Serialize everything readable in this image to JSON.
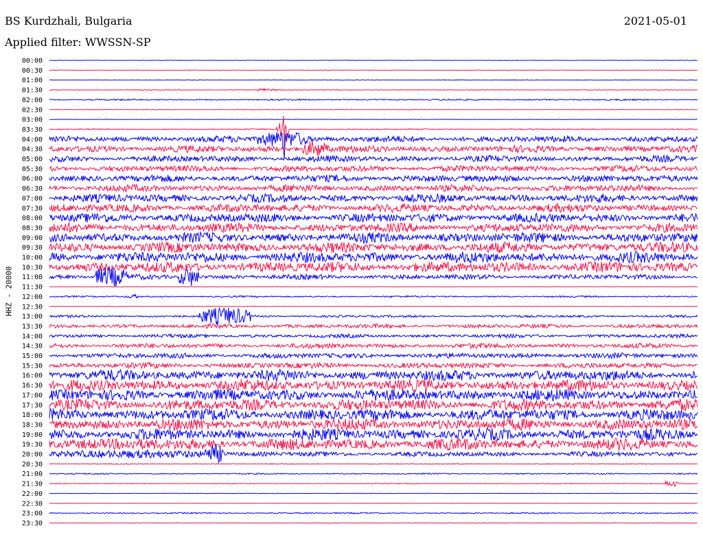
{
  "header": {
    "station": "BS Kurdzhali, Bulgaria",
    "filter": "Applied filter: WWSSN-SP",
    "date": "2021-05-01"
  },
  "chart_data": {
    "type": "line",
    "title": "BS Kurdzhali, Bulgaria",
    "subtitle": "Applied filter: WWSSN-SP",
    "ylabel": "HHZ - 20000",
    "colors": {
      "even_row": "#0000ee",
      "odd_row": "#f0144b"
    },
    "rows": [
      {
        "time": "00:00",
        "noise": 0.3,
        "events": []
      },
      {
        "time": "00:30",
        "noise": 0.3,
        "events": []
      },
      {
        "time": "01:00",
        "noise": 0.3,
        "events": []
      },
      {
        "time": "01:30",
        "noise": 0.4,
        "events": [
          {
            "start": 0.32,
            "end": 0.44,
            "amp": 3,
            "shape": "decay"
          }
        ]
      },
      {
        "time": "02:00",
        "noise": 0.9,
        "events": []
      },
      {
        "time": "02:30",
        "noise": 0.4,
        "events": []
      },
      {
        "time": "03:00",
        "noise": 0.3,
        "events": []
      },
      {
        "time": "03:30",
        "noise": 0.7,
        "events": [
          {
            "start": 0.35,
            "end": 0.37,
            "amp": 40,
            "shape": "spike"
          }
        ]
      },
      {
        "time": "04:00",
        "noise": 3.8,
        "events": [
          {
            "start": 0.32,
            "end": 0.4,
            "amp": 12,
            "shape": "burst"
          },
          {
            "start": 0.359,
            "end": 0.365,
            "amp": 32,
            "shape": "spike"
          }
        ]
      },
      {
        "time": "04:30",
        "noise": 4.2,
        "events": [
          {
            "start": 0.39,
            "end": 0.43,
            "amp": 12,
            "shape": "burst"
          }
        ]
      },
      {
        "time": "05:00",
        "noise": 3.8,
        "events": []
      },
      {
        "time": "05:30",
        "noise": 3.8,
        "events": []
      },
      {
        "time": "06:00",
        "noise": 4.2,
        "events": []
      },
      {
        "time": "06:30",
        "noise": 4.2,
        "events": []
      },
      {
        "time": "07:00",
        "noise": 5,
        "events": []
      },
      {
        "time": "07:30",
        "noise": 5,
        "events": []
      },
      {
        "time": "08:00",
        "noise": 5.5,
        "events": []
      },
      {
        "time": "08:30",
        "noise": 5.5,
        "events": []
      },
      {
        "time": "09:00",
        "noise": 6,
        "events": []
      },
      {
        "time": "09:30",
        "noise": 6.2,
        "events": []
      },
      {
        "time": "10:00",
        "noise": 6.5,
        "events": []
      },
      {
        "time": "10:30",
        "noise": 6.5,
        "events": []
      },
      {
        "time": "11:00",
        "noise": 3,
        "events": [
          {
            "start": 0.07,
            "end": 0.12,
            "amp": 15,
            "shape": "burst"
          },
          {
            "start": 0.2,
            "end": 0.23,
            "amp": 14,
            "shape": "burst"
          }
        ]
      },
      {
        "time": "11:30",
        "noise": 0.3,
        "events": []
      },
      {
        "time": "12:00",
        "noise": 1,
        "events": [
          {
            "start": 0.12,
            "end": 0.14,
            "amp": 3,
            "shape": "burst"
          }
        ]
      },
      {
        "time": "12:30",
        "noise": 0.4,
        "events": []
      },
      {
        "time": "13:00",
        "noise": 1.5,
        "events": [
          {
            "start": 0.23,
            "end": 0.31,
            "amp": 13,
            "shape": "burst"
          }
        ]
      },
      {
        "time": "13:30",
        "noise": 2.5,
        "events": []
      },
      {
        "time": "14:00",
        "noise": 2.2,
        "events": []
      },
      {
        "time": "14:30",
        "noise": 3,
        "events": []
      },
      {
        "time": "15:00",
        "noise": 3.2,
        "events": []
      },
      {
        "time": "15:30",
        "noise": 3.5,
        "events": []
      },
      {
        "time": "16:00",
        "noise": 6.5,
        "events": []
      },
      {
        "time": "16:30",
        "noise": 7,
        "events": []
      },
      {
        "time": "17:00",
        "noise": 7,
        "events": []
      },
      {
        "time": "17:30",
        "noise": 7,
        "events": []
      },
      {
        "time": "18:00",
        "noise": 7,
        "events": []
      },
      {
        "time": "18:30",
        "noise": 7,
        "events": []
      },
      {
        "time": "19:00",
        "noise": 7,
        "events": []
      },
      {
        "time": "19:30",
        "noise": 7,
        "events": [
          {
            "start": 0.0,
            "end": 0.24,
            "amp": 8,
            "shape": "burst"
          }
        ]
      },
      {
        "time": "20:00",
        "noise": 3,
        "events": [
          {
            "start": 0.0,
            "end": 0.27,
            "amp": 6,
            "shape": "burst"
          },
          {
            "start": 0.24,
            "end": 0.27,
            "amp": 14,
            "shape": "burst"
          },
          {
            "start": 0.27,
            "end": 0.41,
            "amp": 3,
            "shape": "decay"
          }
        ]
      },
      {
        "time": "20:30",
        "noise": 0.5,
        "events": []
      },
      {
        "time": "21:00",
        "noise": 0.8,
        "events": []
      },
      {
        "time": "21:30",
        "noise": 0.5,
        "events": [
          {
            "start": 0.95,
            "end": 0.97,
            "amp": 5,
            "shape": "burst"
          }
        ]
      },
      {
        "time": "22:00",
        "noise": 0.3,
        "events": []
      },
      {
        "time": "22:30",
        "noise": 0.3,
        "events": []
      },
      {
        "time": "23:00",
        "noise": 0.8,
        "events": []
      },
      {
        "time": "23:30",
        "noise": 0.3,
        "events": []
      }
    ]
  }
}
